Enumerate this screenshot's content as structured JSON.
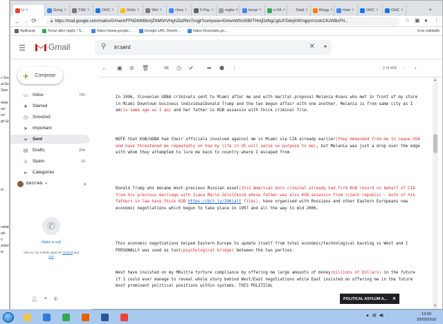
{
  "browser": {
    "tabs": [
      {
        "label": "U",
        "favicon": "gmail-icon",
        "color": "#ea4335",
        "active": true
      },
      {
        "label": "Goog",
        "favicon": "docs-icon",
        "color": "#4285f4"
      },
      {
        "label": "THE",
        "favicon": "page-icon",
        "color": "#777777"
      },
      {
        "label": "OHC",
        "favicon": "page-icon",
        "color": "#1a73e8"
      },
      {
        "label": "Onlin",
        "favicon": "page-icon",
        "color": "#fbbc04"
      },
      {
        "label": "Wirt",
        "favicon": "page-icon",
        "color": "#7b7b7b"
      },
      {
        "label": "chea",
        "favicon": "google-icon",
        "color": "#4285f4"
      },
      {
        "label": "5 Pay",
        "favicon": "page-icon",
        "color": "#5f6368"
      },
      {
        "label": "mgbe",
        "favicon": "page-icon",
        "color": "#9aa0a6"
      },
      {
        "label": "bezpi",
        "favicon": "google-icon",
        "color": "#4285f4"
      },
      {
        "label": "e-FA",
        "favicon": "page-icon",
        "color": "#34a853"
      },
      {
        "label": "Talali",
        "favicon": "page-icon",
        "color": "#e0e0e0"
      },
      {
        "label": "Blogg",
        "favicon": "blogger-icon",
        "color": "#f57d00"
      },
      {
        "label": "How",
        "favicon": "page-icon",
        "color": "#4285f4"
      },
      {
        "label": "OHC",
        "favicon": "page-icon",
        "color": "#1a73e8"
      },
      {
        "label": "OHC",
        "favicon": "page-icon",
        "color": "#1a73e8"
      }
    ],
    "new_tab": "+",
    "url": "https://mail.google.com/mail/u/0/#sent/FFNDWMtbmjZNMtVrVHghZbzRkvTnrgjt?compose=DmwnWtVcKBhTHmjDdNgCgtLtFZdwjXWVqppVUcdcCKzWBsFN...",
    "bookmarks": [
      {
        "label": "Aplikacje",
        "color": "#5f6368"
      },
      {
        "label": "Teraz albo nigdy / S...",
        "color": "#34a853"
      },
      {
        "label": "https://www.google...",
        "color": "#4285f4"
      },
      {
        "label": "Google URL Shorte...",
        "color": "#4285f4"
      },
      {
        "label": "https://translate.go...",
        "color": "#4285f4"
      }
    ],
    "other_bookmarks": "Inne zakładki"
  },
  "gmail": {
    "logo_text": "Gmail",
    "search_value": "in:sent",
    "compose_label": "Compose",
    "nav": [
      {
        "label": "Inbox",
        "icon": "inbox-icon",
        "count": "760"
      },
      {
        "label": "Starred",
        "icon": "star-icon",
        "count": ""
      },
      {
        "label": "Snoozed",
        "icon": "clock-icon",
        "count": ""
      },
      {
        "label": "Important",
        "icon": "important-icon",
        "count": ""
      },
      {
        "label": "Sent",
        "icon": "send-icon",
        "count": "",
        "active": true
      },
      {
        "label": "Drafts",
        "icon": "draft-icon",
        "count": "254"
      },
      {
        "label": "Spam",
        "icon": "spam-icon",
        "count": "10"
      },
      {
        "label": "Categories",
        "icon": "label-icon",
        "count": ""
      }
    ],
    "user_name": "BASTIAN",
    "hangouts": {
      "make_call": "Make a call",
      "apps_text_1": "Also try our mobile apps for",
      "android": "Android",
      "apps_and": "and",
      "ios": "iOS"
    },
    "pager": "2 of 454"
  },
  "email": {
    "p1_a": "In 1996, Slovenian UDBA criminals sent to Miami after me and with marital proposal Melania Knavs who met in front of my store in Miami Downtown business individualDonald Trump and the two begun affair with one another. Melania is from same city as I am",
    "p1_b": "(is same age as I am)",
    "p1_c": " and her father is KGB assassin with thick criminal file.",
    "p2_a": "NOTE that KGB/UDBA had their officials involved against me in Miami via CIA already earlier",
    "p2_b": "(they demanded from me to leave USA and have threatened me repeatedly on how my life in US will serve no purpose to me)",
    "p2_c": ", but Melania was just a drop over the edge with whom they attempted to lure me back to country where I escaped from.",
    "p3_a": "Donald Trump who became most precious Russian asset",
    "p3_b": "(this American born criminal already had firm KGB record on behalf of CIA from his previous marriage with Ivana Marie Zelníčková whose father was also KGB assassin from (czech republic - both of his fathers in law have thick KGB ",
    "p3_link": "https://bit.ly/2O6jalt",
    "p3_c": " files)",
    "p3_d": ", have organised with Russians and other Eastern Europeans new economic negotiations which begun to take place in 1997 and all the way to mid 2006.",
    "p4_a": "This economic negotiations helped Eastern Europe to update itself from total economic/technological backlog vs West and I PERSONALLY was used as tool",
    "p4_b": "(psychological bridge)",
    "p4_c": " between the two parties.",
    "p5_a": "West have insisted on my MKultra torture compliance by offering me large amounts of money",
    "p5_b": "(billions of Dollars)",
    "p5_c": " in the future if I could ever manage to reveal whole story behind West/East negotiations while East insisted on offering me in the future most prominent political positions within systems. THIS POLITICAL"
  },
  "notification": "POLITICAL ASYLUM A...",
  "taskbar": {
    "clock_time": "13:00",
    "clock_date": "20/03/2019",
    "apps": [
      {
        "name": "explorer-icon",
        "color": "#f2c14e"
      },
      {
        "name": "media-icon",
        "color": "#2f7bd9"
      },
      {
        "name": "chrome-icon",
        "color": "#34a853"
      },
      {
        "name": "firefox-icon",
        "color": "#e66000"
      },
      {
        "name": "word-icon",
        "color": "#2b579a"
      },
      {
        "name": "chrome-icon",
        "color": "#ea4335"
      }
    ]
  },
  "bg_window_lines": [
    "s Sed",
    "al Ge",
    "Stan",
    "",
    "elete",
    "ver",
    "ert",
    "gh Em",
    "",
    "",
    "",
    "",
    "",
    "",
    "",
    "",
    "",
    "",
    "m",
    "",
    "",
    "",
    "",
    "",
    "vailab",
    "alo",
    "u",
    "arden",
    "m"
  ]
}
